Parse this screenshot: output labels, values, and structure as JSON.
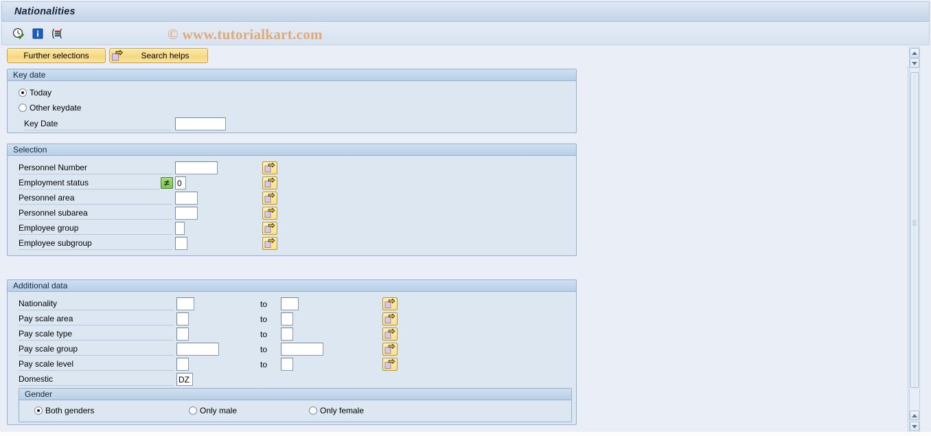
{
  "window": {
    "title": "Nationalities"
  },
  "watermark": "© www.tutorialkart.com",
  "toolbar": {
    "icons": [
      {
        "name": "execute-clock-icon",
        "label": "Execute"
      },
      {
        "name": "info-icon",
        "label": "Information"
      },
      {
        "name": "variant-selection-icon",
        "label": "Get Variant"
      }
    ]
  },
  "buttons": {
    "further_selections": "Further selections",
    "search_helps": "Search helps"
  },
  "key_date": {
    "title": "Key date",
    "options": [
      {
        "label": "Today",
        "selected": true
      },
      {
        "label": "Other keydate",
        "selected": false
      }
    ],
    "key_date_label": "Key Date",
    "key_date_value": ""
  },
  "selection": {
    "title": "Selection",
    "rows": [
      {
        "label": "Personnel Number",
        "value": "",
        "width": 62,
        "operator": "",
        "multi": true
      },
      {
        "label": "Employment status",
        "value": "0",
        "width": 14,
        "operator": "≠",
        "multi": true
      },
      {
        "label": "Personnel area",
        "value": "",
        "width": 33,
        "operator": "",
        "multi": true
      },
      {
        "label": "Personnel subarea",
        "value": "",
        "width": 33,
        "operator": "",
        "multi": true
      },
      {
        "label": "Employee group",
        "value": "",
        "width": 14,
        "operator": "",
        "multi": true
      },
      {
        "label": "Employee subgroup",
        "value": "",
        "width": 18,
        "operator": "",
        "multi": true
      }
    ]
  },
  "additional_data": {
    "title": "Additional data",
    "to_label": "to",
    "rows": [
      {
        "label": "Nationality",
        "from": "",
        "to": "",
        "from_width": 26,
        "to_width": 26,
        "has_range": true,
        "multi": true
      },
      {
        "label": "Pay scale area",
        "from": "",
        "to": "",
        "from_width": 18,
        "to_width": 18,
        "has_range": true,
        "multi": true
      },
      {
        "label": "Pay scale type",
        "from": "",
        "to": "",
        "from_width": 18,
        "to_width": 18,
        "has_range": true,
        "multi": true
      },
      {
        "label": "Pay scale group",
        "from": "",
        "to": "",
        "from_width": 62,
        "to_width": 62,
        "has_range": true,
        "multi": true
      },
      {
        "label": "Pay scale level",
        "from": "",
        "to": "",
        "from_width": 18,
        "to_width": 18,
        "has_range": true,
        "multi": true
      },
      {
        "label": "Domestic",
        "from": "DZ",
        "to": "",
        "from_width": 24,
        "to_width": 0,
        "has_range": false,
        "multi": false
      }
    ],
    "gender": {
      "title": "Gender",
      "options": [
        {
          "label": "Both genders",
          "selected": true
        },
        {
          "label": "Only male",
          "selected": false
        },
        {
          "label": "Only female",
          "selected": false
        }
      ]
    }
  },
  "colors": {
    "accent": "#b9d0e7",
    "button": "#f8dd8c",
    "group_bg": "#dde7f2",
    "page_bg": "#eaeff7",
    "watermark": "#e3a877"
  }
}
